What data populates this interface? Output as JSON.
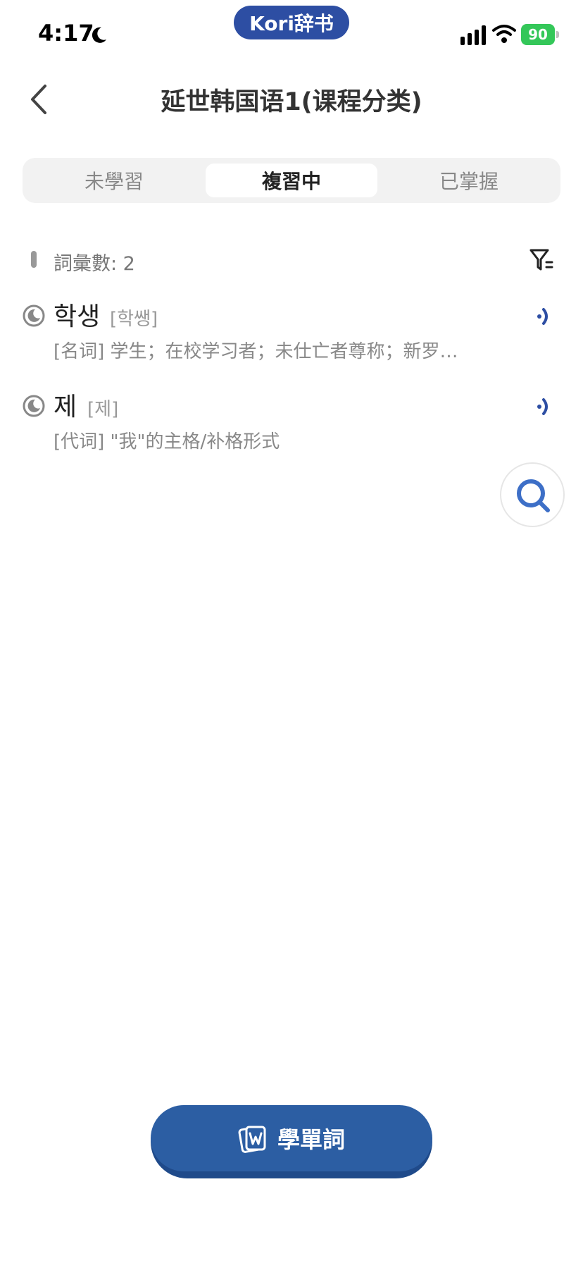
{
  "status_bar": {
    "time": "4:17",
    "app_badge": "Kori辞书",
    "battery_level": "90"
  },
  "header": {
    "title": "延世韩国语1(课程分类)"
  },
  "tabs": [
    {
      "label": "未學習",
      "selected": false
    },
    {
      "label": "複習中",
      "selected": true
    },
    {
      "label": "已掌握",
      "selected": false
    }
  ],
  "summary": {
    "count_label": "詞彙數: 2"
  },
  "words": [
    {
      "headword": "학생",
      "pronunciation": "[학쌩]",
      "definition": "[名词] 学生；在校学习者；未仕亡者尊称；新罗…"
    },
    {
      "headword": "제",
      "pronunciation": "[제]",
      "definition": "[代词] \"我\"的主格/补格形式"
    }
  ],
  "footer": {
    "learn_button_label": "學單詞"
  },
  "colors": {
    "brand": "#2d4ea3",
    "button": "#2c5ea3",
    "battery": "#34c759"
  }
}
